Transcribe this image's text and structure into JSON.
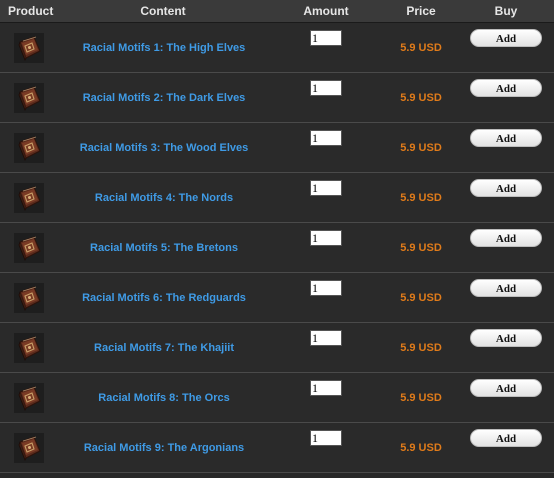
{
  "header": {
    "product": "Product",
    "content": "Content",
    "amount": "Amount",
    "price": "Price",
    "buy": "Buy"
  },
  "rows": [
    {
      "content": "Racial Motifs 1: The High Elves",
      "amount": "1",
      "price": "5.9 USD",
      "buy_label": "Add",
      "icon": "book-icon"
    },
    {
      "content": "Racial Motifs 2: The Dark Elves",
      "amount": "1",
      "price": "5.9 USD",
      "buy_label": "Add",
      "icon": "book-icon"
    },
    {
      "content": "Racial Motifs 3: The Wood Elves",
      "amount": "1",
      "price": "5.9 USD",
      "buy_label": "Add",
      "icon": "book-icon"
    },
    {
      "content": "Racial Motifs 4: The Nords",
      "amount": "1",
      "price": "5.9 USD",
      "buy_label": "Add",
      "icon": "book-icon"
    },
    {
      "content": "Racial Motifs 5: The Bretons",
      "amount": "1",
      "price": "5.9 USD",
      "buy_label": "Add",
      "icon": "book-icon"
    },
    {
      "content": "Racial Motifs 6: The Redguards",
      "amount": "1",
      "price": "5.9 USD",
      "buy_label": "Add",
      "icon": "book-icon"
    },
    {
      "content": "Racial Motifs 7: The Khajiit",
      "amount": "1",
      "price": "5.9 USD",
      "buy_label": "Add",
      "icon": "book-icon"
    },
    {
      "content": "Racial Motifs 8: The Orcs",
      "amount": "1",
      "price": "5.9 USD",
      "buy_label": "Add",
      "icon": "book-icon"
    },
    {
      "content": "Racial Motifs 9: The Argonians",
      "amount": "1",
      "price": "5.9 USD",
      "buy_label": "Add",
      "icon": "book-icon"
    }
  ],
  "colors": {
    "background": "#282828",
    "content_link": "#3f9be6",
    "price": "#e07b1a",
    "header_text": "#e6e6e6"
  }
}
